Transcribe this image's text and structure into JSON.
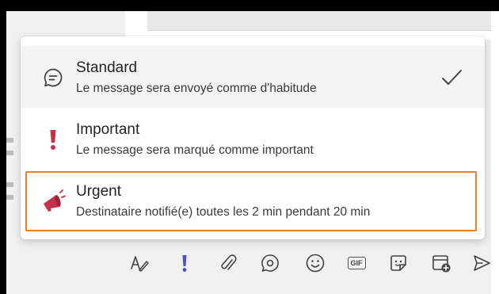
{
  "menu": {
    "items": [
      {
        "title": "Standard",
        "description": "Le message sera envoyé comme d'habitude",
        "icon": "speech-bubble-icon",
        "selected": true
      },
      {
        "title": "Important",
        "description": "Le message sera marqué comme important",
        "icon": "exclamation-icon",
        "icon_color": "#c4314b"
      },
      {
        "title": "Urgent",
        "description": "Destinataire notifié(e) toutes les 2 min pendant 20 min",
        "icon": "megaphone-icon",
        "icon_color": "#c4314b",
        "focused": true
      }
    ]
  },
  "toolbar": {
    "icons": [
      "format-icon",
      "priority-icon",
      "attach-icon",
      "loop-icon",
      "emoji-icon",
      "gif-icon",
      "sticker-icon",
      "schedule-meeting-icon",
      "send-icon"
    ],
    "gif_label": "GIF",
    "priority_color": "#4f52b2"
  },
  "colors": {
    "focus_ring": "#e0822a",
    "selected_bg": "#f4f4f4"
  }
}
